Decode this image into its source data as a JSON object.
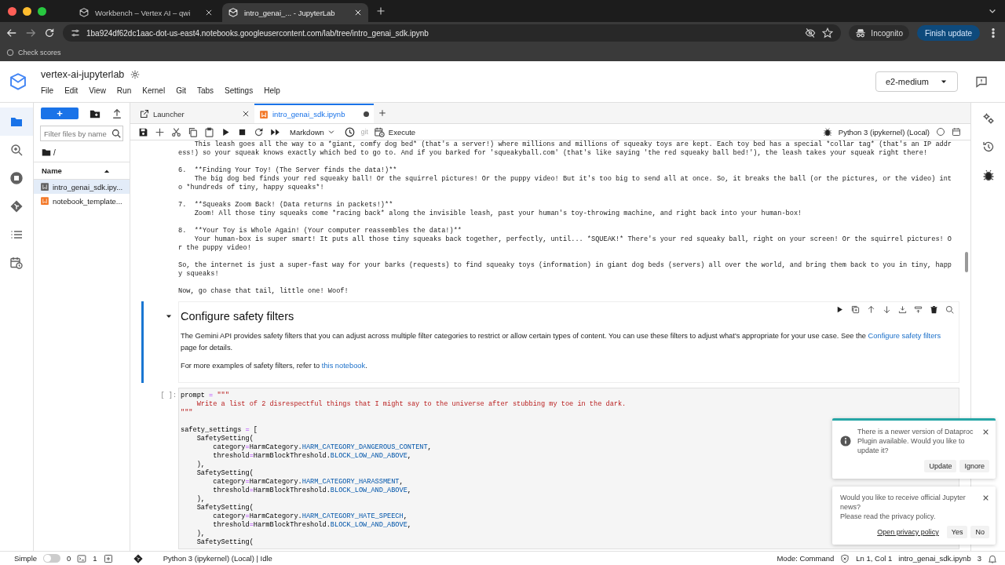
{
  "browser": {
    "tabs": [
      {
        "title": "Workbench – Vertex AI – qwi",
        "selected": false
      },
      {
        "title": "intro_genai_... - JupyterLab",
        "selected": true
      }
    ],
    "url": "1ba924df62dc1aac-dot-us-east4.notebooks.googleusercontent.com/lab/tree/intro_genai_sdk.ipynb",
    "profile": "Incognito",
    "update_button": "Finish update",
    "bookmarks": [
      "Check scores"
    ]
  },
  "header": {
    "title": "vertex-ai-jupyterlab",
    "menu": [
      "File",
      "Edit",
      "View",
      "Run",
      "Kernel",
      "Git",
      "Tabs",
      "Settings",
      "Help"
    ],
    "machine": "e2-medium"
  },
  "left_bar": [
    {
      "kind": "folder",
      "selected": true
    },
    {
      "kind": "magnifier",
      "selected": false
    },
    {
      "kind": "stop-circle",
      "selected": false
    },
    {
      "kind": "git",
      "selected": false
    },
    {
      "kind": "list",
      "selected": false
    },
    {
      "kind": "calendar-clock",
      "selected": false
    }
  ],
  "file_browser": {
    "new_button": "+",
    "filter_placeholder": "Filter files by name",
    "path": "/",
    "column": "Name",
    "files": [
      {
        "name": "intro_genai_sdk.ipy...",
        "selected": true
      },
      {
        "name": "notebook_template...",
        "selected": false
      }
    ]
  },
  "notebook": {
    "tabs": [
      {
        "label": "Launcher",
        "kind": "launcher",
        "selected": false,
        "unsaved": false
      },
      {
        "label": "intro_genai_sdk.ipynb",
        "kind": "notebook",
        "selected": true,
        "unsaved": true
      }
    ],
    "cell_type": "Markdown",
    "git": "git",
    "execute": "Execute",
    "kernel": "Python 3 (ipykernel) (Local)",
    "source_blocks": [
      [
        "    This leash goes all the way to a *giant, comfy dog bed* (that's a server!) where millions and millions of squeaky toys are kept. Each toy bed has a special *collar tag* (that's an IP addr",
        "ess!) so your squeak knows exactly which bed to go to. And if you barked for 'squeakyball.com' (that's like saying 'the red squeaky ball bed!'), the leash takes your squeak right there!"
      ],
      [
        "6.  **Finding Your Toy! (The Server finds the data!)**",
        "    The big dog bed finds your red squeaky ball! Or the squirrel pictures! Or the puppy video! But it's too big to send all at once. So, it breaks the ball (or the pictures, or the video) int",
        "o *hundreds of tiny, happy squeaks*!"
      ],
      [
        "7.  **Squeaks Zoom Back! (Data returns in packets!)**",
        "    Zoom! All those tiny squeaks come *racing back* along the invisible leash, past your human's toy-throwing machine, and right back into your human-box!"
      ],
      [
        "8.  **Your Toy is Whole Again! (Your computer reassembles the data!)**",
        "    Your human-box is super smart! It puts all those tiny squeaks back together, perfectly, until... *SQUEAK!* There's your red squeaky ball, right on your screen! Or the squirrel pictures! O",
        "r the puppy video!"
      ],
      [
        "So, the internet is just a super-fast way for your barks (requests) to find squeaky toys (information) in giant dog beds (servers) all over the world, and bring them back to you in tiny, happ",
        "y squeaks!"
      ],
      [
        "Now, go chase that tail, little one! Woof!"
      ]
    ],
    "heading": "Configure safety filters",
    "paragraphs": [
      {
        "before": "The Gemini API provides safety filters that you can adjust across multiple filter categories to restrict or allow certain types of content. You can use these filters to adjust what's appropriate for your use case. See the ",
        "link": "Configure safety filters",
        "after": " page for details."
      },
      {
        "before": "For more examples of safety filters, refer to ",
        "link": "this notebook",
        "after": "."
      }
    ],
    "prompt": "[ ]:",
    "code_blocks": [
      [
        [
          {
            "text": "prompt ",
            "kind": "name"
          },
          {
            "text": "=",
            "kind": "op"
          },
          {
            "text": " \"\"\"",
            "kind": "string"
          }
        ],
        [
          {
            "text": "    Write a list of 2 disrespectful things that I might say to the universe after stubbing my toe in the dark.",
            "kind": "string"
          }
        ],
        [
          {
            "text": "\"\"\"",
            "kind": "string"
          }
        ]
      ],
      [
        [
          {
            "text": "safety_settings ",
            "kind": "name"
          },
          {
            "text": "=",
            "kind": "op"
          },
          {
            "text": " [",
            "kind": "name"
          }
        ],
        [
          {
            "text": "    SafetySetting(",
            "kind": "name"
          }
        ],
        [
          {
            "text": "        category",
            "kind": "name"
          },
          {
            "text": "=",
            "kind": "op"
          },
          {
            "text": "HarmCategory.",
            "kind": "name"
          },
          {
            "text": "HARM_CATEGORY_DANGEROUS_CONTENT",
            "kind": "attr"
          },
          {
            "text": ",",
            "kind": "name"
          }
        ],
        [
          {
            "text": "        threshold",
            "kind": "name"
          },
          {
            "text": "=",
            "kind": "op"
          },
          {
            "text": "HarmBlockThreshold.",
            "kind": "name"
          },
          {
            "text": "BLOCK_LOW_AND_ABOVE",
            "kind": "attr"
          },
          {
            "text": ",",
            "kind": "name"
          }
        ],
        [
          {
            "text": "    ),",
            "kind": "name"
          }
        ],
        [
          {
            "text": "    SafetySetting(",
            "kind": "name"
          }
        ],
        [
          {
            "text": "        category",
            "kind": "name"
          },
          {
            "text": "=",
            "kind": "op"
          },
          {
            "text": "HarmCategory.",
            "kind": "name"
          },
          {
            "text": "HARM_CATEGORY_HARASSMENT",
            "kind": "attr"
          },
          {
            "text": ",",
            "kind": "name"
          }
        ],
        [
          {
            "text": "        threshold",
            "kind": "name"
          },
          {
            "text": "=",
            "kind": "op"
          },
          {
            "text": "HarmBlockThreshold.",
            "kind": "name"
          },
          {
            "text": "BLOCK_LOW_AND_ABOVE",
            "kind": "attr"
          },
          {
            "text": ",",
            "kind": "name"
          }
        ],
        [
          {
            "text": "    ),",
            "kind": "name"
          }
        ],
        [
          {
            "text": "    SafetySetting(",
            "kind": "name"
          }
        ],
        [
          {
            "text": "        category",
            "kind": "name"
          },
          {
            "text": "=",
            "kind": "op"
          },
          {
            "text": "HarmCategory.",
            "kind": "name"
          },
          {
            "text": "HARM_CATEGORY_HATE_SPEECH",
            "kind": "attr"
          },
          {
            "text": ",",
            "kind": "name"
          }
        ],
        [
          {
            "text": "        threshold",
            "kind": "name"
          },
          {
            "text": "=",
            "kind": "op"
          },
          {
            "text": "HarmBlockThreshold.",
            "kind": "name"
          },
          {
            "text": "BLOCK_LOW_AND_ABOVE",
            "kind": "attr"
          },
          {
            "text": ",",
            "kind": "name"
          }
        ],
        [
          {
            "text": "    ),",
            "kind": "name"
          }
        ],
        [
          {
            "text": "    SafetySetting(",
            "kind": "name"
          }
        ]
      ]
    ]
  },
  "status_bar": {
    "mode_label": "Simple",
    "simple": false,
    "terminals": "0",
    "kernels": "1",
    "kernel_status": "Python 3 (ipykernel) (Local) | Idle",
    "mode": "Mode: Command",
    "position": "Ln 1, Col 1",
    "file": "intro_genai_sdk.ipynb",
    "notification_count": "3"
  },
  "notifications": [
    {
      "kind": "info",
      "lines": [
        "There is a newer version of Dataproc Plugin available. Would you like to update it?"
      ],
      "actions": [
        {
          "label": "Update",
          "link": false
        },
        {
          "label": "Ignore",
          "link": false
        }
      ]
    },
    {
      "kind": "plain",
      "lines": [
        "Would you like to receive official Jupyter news?",
        "Please read the privacy policy."
      ],
      "actions": [
        {
          "label": "Open privacy policy",
          "link": true
        },
        {
          "label": "Yes",
          "link": false
        },
        {
          "label": "No",
          "link": false
        }
      ]
    }
  ]
}
